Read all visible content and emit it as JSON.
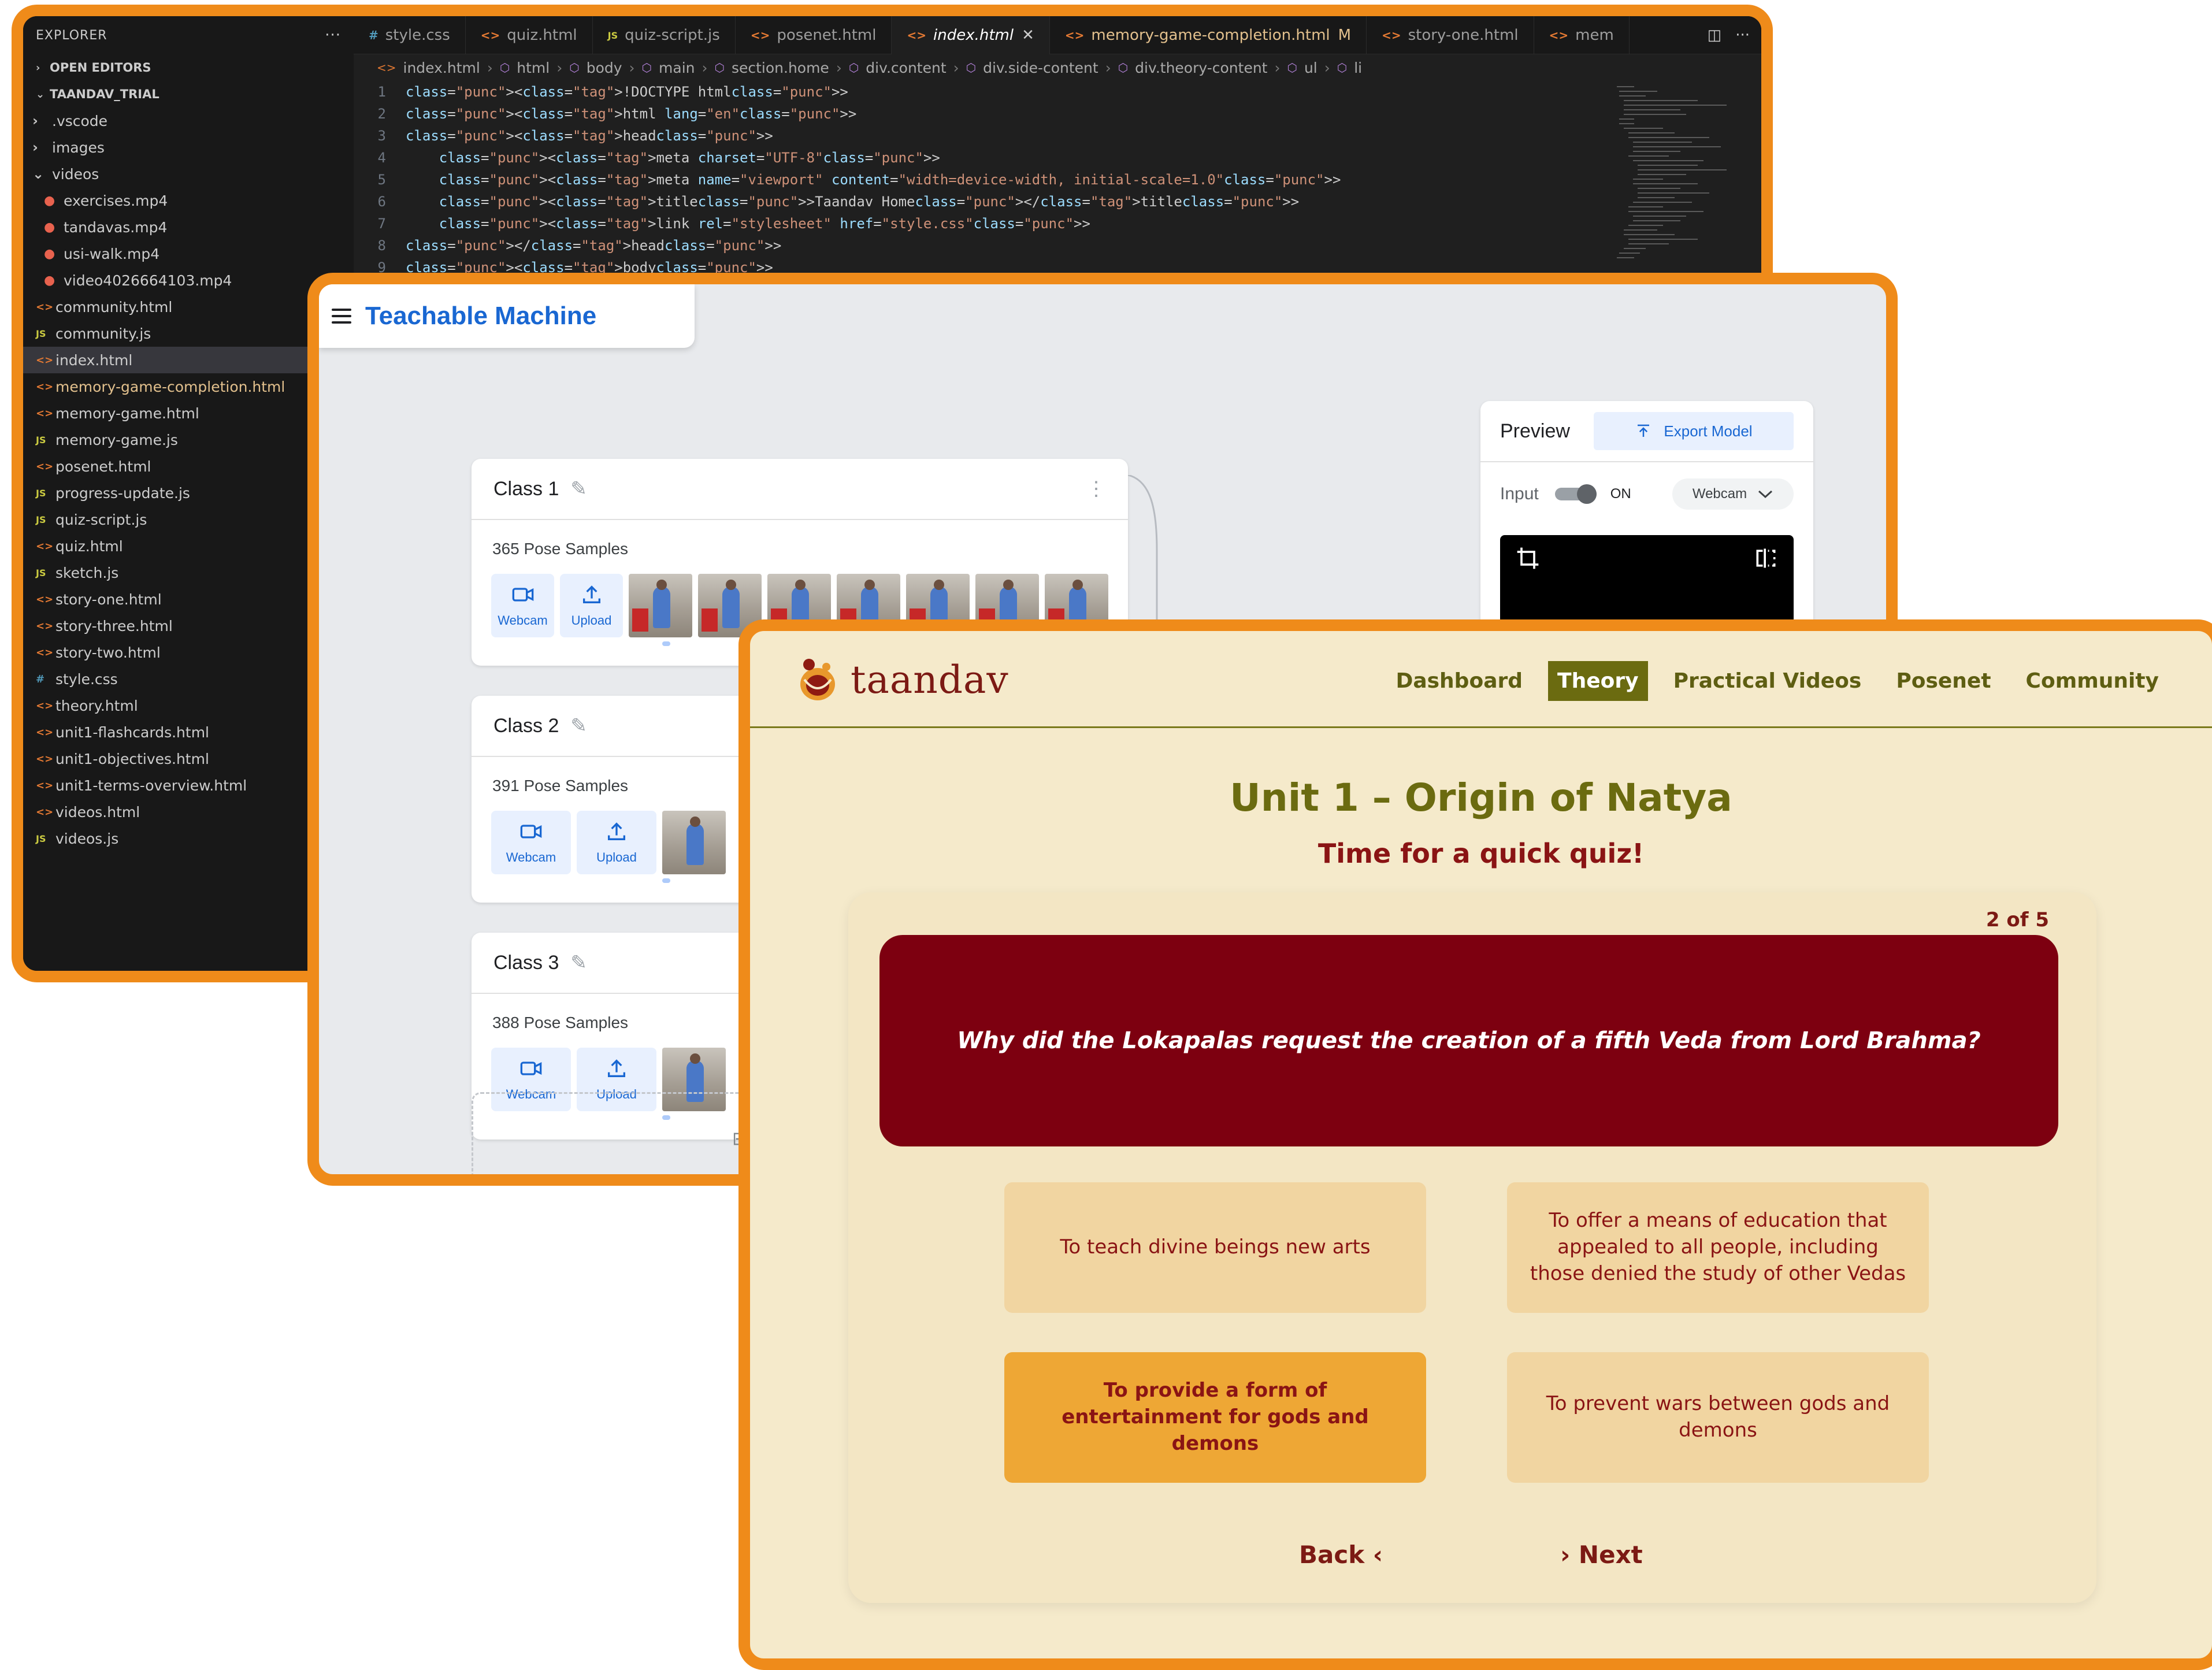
{
  "vscode": {
    "explorer_title": "EXPLORER",
    "open_editors_label": "OPEN EDITORS",
    "project_label": "TAANDAV_TRIAL",
    "tree": [
      {
        "name": ".vscode",
        "kind": "folder-closed"
      },
      {
        "name": "images",
        "kind": "folder-closed"
      },
      {
        "name": "videos",
        "kind": "folder-open"
      },
      {
        "name": "exercises.mp4",
        "kind": "mp4"
      },
      {
        "name": "tandavas.mp4",
        "kind": "mp4"
      },
      {
        "name": "usi-walk.mp4",
        "kind": "mp4"
      },
      {
        "name": "video4026664103.mp4",
        "kind": "mp4"
      },
      {
        "name": "community.html",
        "kind": "html"
      },
      {
        "name": "community.js",
        "kind": "js"
      },
      {
        "name": "index.html",
        "kind": "html",
        "selected": true
      },
      {
        "name": "memory-game-completion.html",
        "kind": "html",
        "modified": true
      },
      {
        "name": "memory-game.html",
        "kind": "html"
      },
      {
        "name": "memory-game.js",
        "kind": "js"
      },
      {
        "name": "posenet.html",
        "kind": "html"
      },
      {
        "name": "progress-update.js",
        "kind": "js"
      },
      {
        "name": "quiz-script.js",
        "kind": "js"
      },
      {
        "name": "quiz.html",
        "kind": "html"
      },
      {
        "name": "sketch.js",
        "kind": "js"
      },
      {
        "name": "story-one.html",
        "kind": "html"
      },
      {
        "name": "story-three.html",
        "kind": "html"
      },
      {
        "name": "story-two.html",
        "kind": "html"
      },
      {
        "name": "style.css",
        "kind": "css"
      },
      {
        "name": "theory.html",
        "kind": "html"
      },
      {
        "name": "unit1-flashcards.html",
        "kind": "html"
      },
      {
        "name": "unit1-objectives.html",
        "kind": "html"
      },
      {
        "name": "unit1-terms-overview.html",
        "kind": "html"
      },
      {
        "name": "videos.html",
        "kind": "html"
      },
      {
        "name": "videos.js",
        "kind": "js"
      }
    ],
    "tabs": [
      {
        "name": "style.css",
        "kind": "css"
      },
      {
        "name": "quiz.html",
        "kind": "html"
      },
      {
        "name": "quiz-script.js",
        "kind": "js"
      },
      {
        "name": "posenet.html",
        "kind": "html"
      },
      {
        "name": "index.html",
        "kind": "html",
        "active": true
      },
      {
        "name": "memory-game-completion.html",
        "kind": "html",
        "modified": true,
        "flag": "M"
      },
      {
        "name": "story-one.html",
        "kind": "html"
      },
      {
        "name": "mem",
        "kind": "html"
      }
    ],
    "breadcrumbs": [
      "index.html",
      "html",
      "body",
      "main",
      "section.home",
      "div.content",
      "div.side-content",
      "div.theory-content",
      "ul",
      "li"
    ],
    "code_lines": [
      {
        "n": "1",
        "text": "<!DOCTYPE html>"
      },
      {
        "n": "2",
        "text": "<html lang=\"en\">"
      },
      {
        "n": "3",
        "text": "<head>"
      },
      {
        "n": "4",
        "text": "    <meta charset=\"UTF-8\">"
      },
      {
        "n": "5",
        "text": "    <meta name=\"viewport\" content=\"width=device-width, initial-scale=1.0\">"
      },
      {
        "n": "6",
        "text": "    <title>Taandav Home</title>"
      },
      {
        "n": "7",
        "text": "    <link rel=\"stylesheet\" href=\"style.css\">"
      },
      {
        "n": "8",
        "text": "</head>"
      },
      {
        "n": "9",
        "text": "<body>"
      }
    ]
  },
  "tm": {
    "title": "Teachable Machine",
    "classes": [
      {
        "name": "Class 1",
        "samples": "365 Pose Samples"
      },
      {
        "name": "Class 2",
        "samples": "391 Pose Samples"
      },
      {
        "name": "Class 3",
        "samples": "388 Pose Samples"
      }
    ],
    "webcam_label": "Webcam",
    "upload_label": "Upload",
    "preview_title": "Preview",
    "export_label": "Export Model",
    "input_label": "Input",
    "on_label": "ON",
    "source_select": "Webcam"
  },
  "taandav": {
    "brand": "taandav",
    "nav": [
      {
        "label": "Dashboard"
      },
      {
        "label": "Theory",
        "active": true
      },
      {
        "label": "Practical Videos"
      },
      {
        "label": "Posenet"
      },
      {
        "label": "Community"
      }
    ],
    "unit_title": "Unit 1 –  Origin of Natya",
    "subtitle": "Time for a quick quiz!",
    "counter": "2 of 5",
    "question": "Why did the Lokapalas request the creation of a fifth Veda from Lord Brahma?",
    "options": [
      {
        "text": "To teach divine beings new arts"
      },
      {
        "text": "To offer a means of education that appealed to all people, including those denied the study of other Vedas"
      },
      {
        "text": "To provide a form of entertainment for gods and demons",
        "selected": true
      },
      {
        "text": "To prevent wars between gods and demons"
      }
    ],
    "back_label": "Back ‹",
    "next_label": "› Next",
    "colors": {
      "frame": "#ef8b1a",
      "background": "#f5eacb",
      "question_bg": "#7d0010",
      "option_bg": "#f1d5a1",
      "option_selected_bg": "#eea735",
      "nav_active_bg": "#6b6b10",
      "text_maroon": "#7c1a14"
    }
  }
}
